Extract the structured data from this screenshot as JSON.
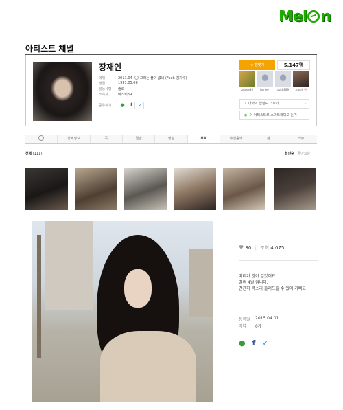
{
  "logo": {
    "text": "Melon"
  },
  "page": {
    "title": "아티스트 채널"
  },
  "artist": {
    "name": "장재인",
    "rows": [
      {
        "label": "데뷔",
        "value": "2011.04",
        "extra": "그래는 불이 없네 (Feat. 김지수)"
      },
      {
        "label": "생일",
        "value": "1991.05.06"
      },
      {
        "label": "활동유형",
        "value": "솔로"
      },
      {
        "label": "소속사",
        "value": "미스틱89"
      },
      {
        "label": "공유하기",
        "value": ""
      }
    ]
  },
  "fan": {
    "button_label": "팬맺기",
    "count": "5,147명"
  },
  "fans": [
    {
      "name": "znyee89"
    },
    {
      "name": "honee_"
    },
    {
      "name": "sgk8889"
    },
    {
      "name": "꼬꼬마_권"
    }
  ],
  "side_buttons": [
    {
      "label": "나와의 친밀도 더보기"
    },
    {
      "label": "이 아티스트로 스마트라디오 듣기"
    }
  ],
  "tabs": [
    {
      "label": "",
      "icon": "clock-icon"
    },
    {
      "label": "상세정보"
    },
    {
      "label": "곡"
    },
    {
      "label": "앨범"
    },
    {
      "label": "영상"
    },
    {
      "label": "포토",
      "active": true
    },
    {
      "label": "추천음악"
    },
    {
      "label": "팬"
    },
    {
      "label": "리뷰"
    }
  ],
  "photos": {
    "total_label": "전체",
    "total_count": "(111)",
    "sort_active": "최신순",
    "sort_other": "좋아요순"
  },
  "detail": {
    "likes": "30",
    "views_label": "조회",
    "views": "4,075",
    "description": [
      "머리가 많이 길었어요",
      "벌써 4월 입니다.",
      "간간히 목소리 들려드릴 수 있어 기뻐요"
    ],
    "date_label": "등록일",
    "date": "2015.04.01",
    "review_label": "리뷰",
    "review": "0개"
  },
  "colors": {
    "accent": "#f5a300",
    "brand": "#1faa00",
    "facebook": "#3b5998",
    "twitter": "#1da1f2"
  }
}
